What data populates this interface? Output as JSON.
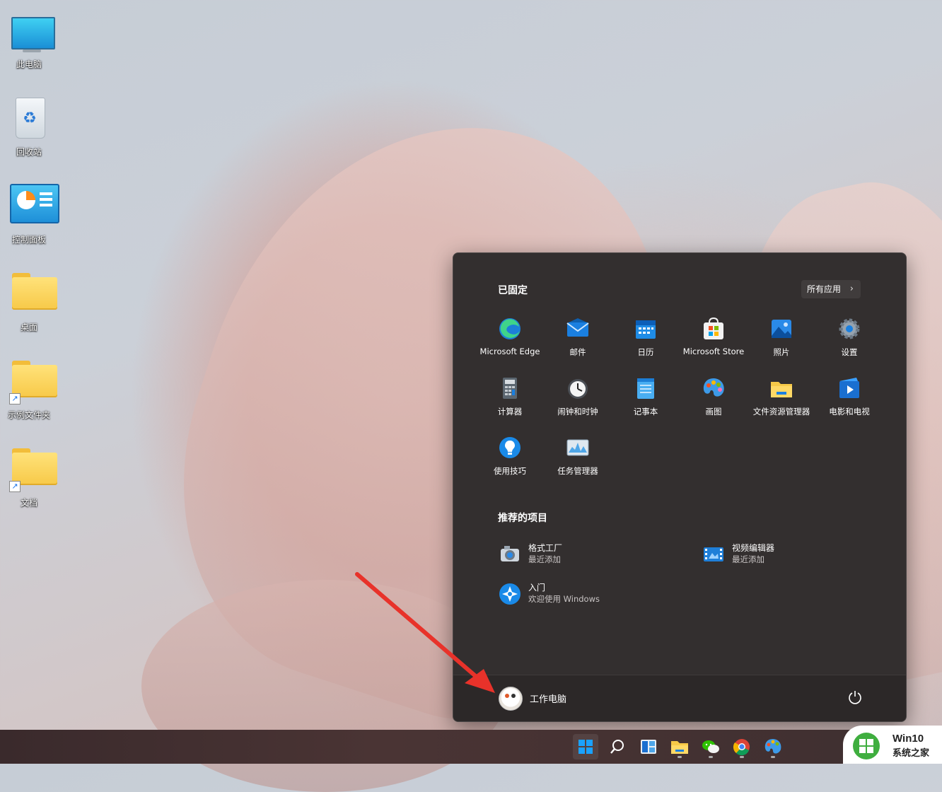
{
  "desktop": {
    "icons": [
      {
        "label": "此电脑",
        "icon": "this-pc-icon"
      },
      {
        "label": "回收站",
        "icon": "recycle-bin-icon"
      },
      {
        "label": "控制面板",
        "icon": "control-panel-icon"
      },
      {
        "label": "桌面",
        "icon": "folder-icon"
      },
      {
        "label": "示例文件夹",
        "icon": "folder-shortcut-icon"
      },
      {
        "label": "文档",
        "icon": "folder-shortcut-icon"
      }
    ]
  },
  "start_menu": {
    "pinned_title": "已固定",
    "all_apps_label": "所有应用",
    "pinned": [
      {
        "label": "Microsoft Edge",
        "icon": "edge-icon"
      },
      {
        "label": "邮件",
        "icon": "mail-icon"
      },
      {
        "label": "日历",
        "icon": "calendar-icon"
      },
      {
        "label": "Microsoft Store",
        "icon": "store-icon"
      },
      {
        "label": "照片",
        "icon": "photos-icon"
      },
      {
        "label": "设置",
        "icon": "settings-icon"
      },
      {
        "label": "计算器",
        "icon": "calculator-icon"
      },
      {
        "label": "闹钟和时钟",
        "icon": "clock-icon"
      },
      {
        "label": "记事本",
        "icon": "notepad-icon"
      },
      {
        "label": "画图",
        "icon": "paint-icon"
      },
      {
        "label": "文件资源管理器",
        "icon": "file-explorer-icon"
      },
      {
        "label": "电影和电视",
        "icon": "movies-icon"
      },
      {
        "label": "使用技巧",
        "icon": "tips-icon"
      },
      {
        "label": "任务管理器",
        "icon": "task-manager-icon"
      }
    ],
    "recommended_title": "推荐的项目",
    "recommended": [
      {
        "title": "格式工厂",
        "subtitle": "最近添加",
        "icon": "format-factory-icon"
      },
      {
        "title": "视频编辑器",
        "subtitle": "最近添加",
        "icon": "video-editor-icon"
      },
      {
        "title": "入门",
        "subtitle": "欢迎使用 Windows",
        "icon": "get-started-icon"
      }
    ],
    "user_name": "工作电脑"
  },
  "taskbar": {
    "items": [
      "start-icon",
      "search-icon",
      "widgets-icon",
      "file-explorer-icon",
      "wechat-icon",
      "chrome-icon",
      "paint-icon"
    ]
  },
  "watermark": {
    "line1": "Win10",
    "line2": "系统之家"
  },
  "colors": {
    "accent": "#1aa2ff",
    "annotation_arrow": "#e8322a",
    "menu_bg": "#332f2f"
  }
}
